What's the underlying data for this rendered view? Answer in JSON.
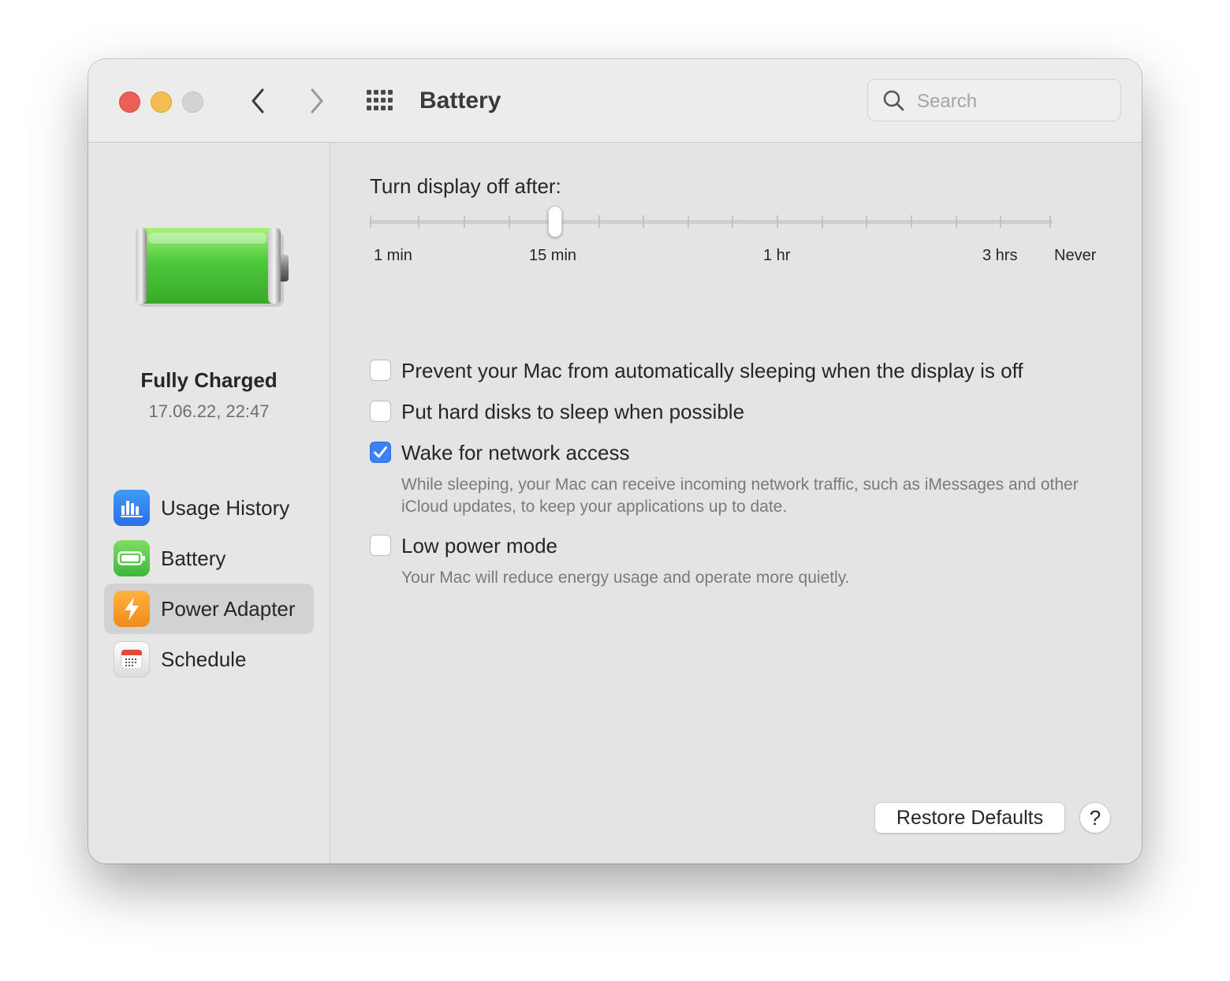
{
  "window": {
    "title": "Battery"
  },
  "search": {
    "placeholder": "Search"
  },
  "status": {
    "title": "Fully Charged",
    "time": "17.06.22, 22:47"
  },
  "sidebar": {
    "items": [
      {
        "label": "Usage History",
        "icon": "bar-chart-icon"
      },
      {
        "label": "Battery",
        "icon": "battery-icon"
      },
      {
        "label": "Power Adapter",
        "icon": "lightning-bolt-icon",
        "selected": true
      },
      {
        "label": "Schedule",
        "icon": "calendar-icon"
      }
    ]
  },
  "display_slider": {
    "label": "Turn display off after:",
    "tick_labels": [
      "1 min",
      "15 min",
      "1 hr",
      "3 hrs",
      "Never"
    ],
    "value": "15 min"
  },
  "options": [
    {
      "label": "Prevent your Mac from automatically sleeping when the display is off",
      "checked": false
    },
    {
      "label": "Put hard disks to sleep when possible",
      "checked": false
    },
    {
      "label": "Wake for network access",
      "checked": true,
      "description": "While sleeping, your Mac can receive incoming network traffic, such as iMessages and other iCloud updates, to keep your applications up to date."
    },
    {
      "label": "Low power mode",
      "checked": false,
      "description": "Your Mac will reduce energy usage and operate more quietly."
    }
  ],
  "buttons": {
    "restore": "Restore Defaults",
    "help": "?"
  },
  "colors": {
    "accent": "#3b82f6",
    "battery_green": "#4cc93a",
    "close": "#ec5f59",
    "minimize": "#f4bd4f"
  }
}
